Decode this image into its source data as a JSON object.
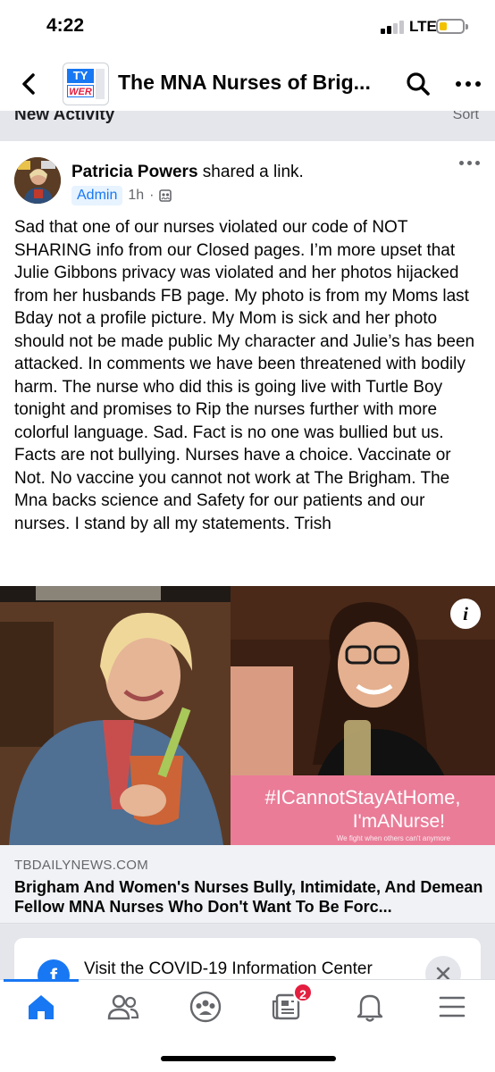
{
  "status_bar": {
    "time": "4:22",
    "network": "LTE",
    "battery_level": 0.25,
    "battery_color": "#f2c200"
  },
  "header": {
    "back_icon": "chevron-left-icon",
    "group_thumb_top": "TY",
    "group_thumb_bottom": "WER",
    "title": "The MNA Nurses of Brig...",
    "search_icon": "search-icon",
    "more_icon": "more-horizontal-icon"
  },
  "section": {
    "label": "New Activity",
    "sort_label": "Sort"
  },
  "post": {
    "author": "Patricia Powers",
    "action": " shared a link.",
    "role_badge": "Admin",
    "time": "1h",
    "privacy_icon": "group-privacy-icon",
    "text": "Sad that one of our nurses violated our code of NOT SHARING info from our Closed pages. I’m more upset that Julie Gibbons privacy was violated and her photos hijacked from her husbands FB page. My photo is from my Moms last Bday not a profile picture.  My Mom is sick and her photo should not be made public My character and Julie’s  has been attacked. In comments we have been threatened with bodily harm. The nurse who did this is going live with Turtle Boy tonight and promises to Rip the nurses further with more colorful language. Sad. Fact is no one was bullied but us. Facts are not bullying. Nurses have a choice. Vaccinate or Not. No vaccine you cannot not work at The Brigham. The Mna backs science and Safety for our patients and our nurses.   I stand by all my statements.  Trish",
    "image": {
      "info_label": "i",
      "hashtag_line1": "#ICannotStayAtHome,",
      "hashtag_line2": "I'mANurse!",
      "hashtag_line3": "We fight when others can't anymore"
    },
    "link": {
      "domain": "TBDAILYNEWS.COM",
      "title": "Brigham And Women's Nurses Bully, Intimidate, And Demean Fellow MNA Nurses Who Don't Want To Be Forc..."
    }
  },
  "covid_card": {
    "icon_letter": "f",
    "text": "Visit the COVID-19 Information Center"
  },
  "tab_bar": {
    "tabs": [
      {
        "name": "home",
        "icon": "home-icon",
        "active": true
      },
      {
        "name": "friends",
        "icon": "friends-icon",
        "active": false
      },
      {
        "name": "groups",
        "icon": "groups-icon",
        "active": false
      },
      {
        "name": "news",
        "icon": "news-icon",
        "active": false
      },
      {
        "name": "notifications",
        "icon": "bell-icon",
        "active": false
      },
      {
        "name": "menu",
        "icon": "menu-icon",
        "active": false
      }
    ],
    "news_badge": "2",
    "accent": "#1877f2"
  }
}
